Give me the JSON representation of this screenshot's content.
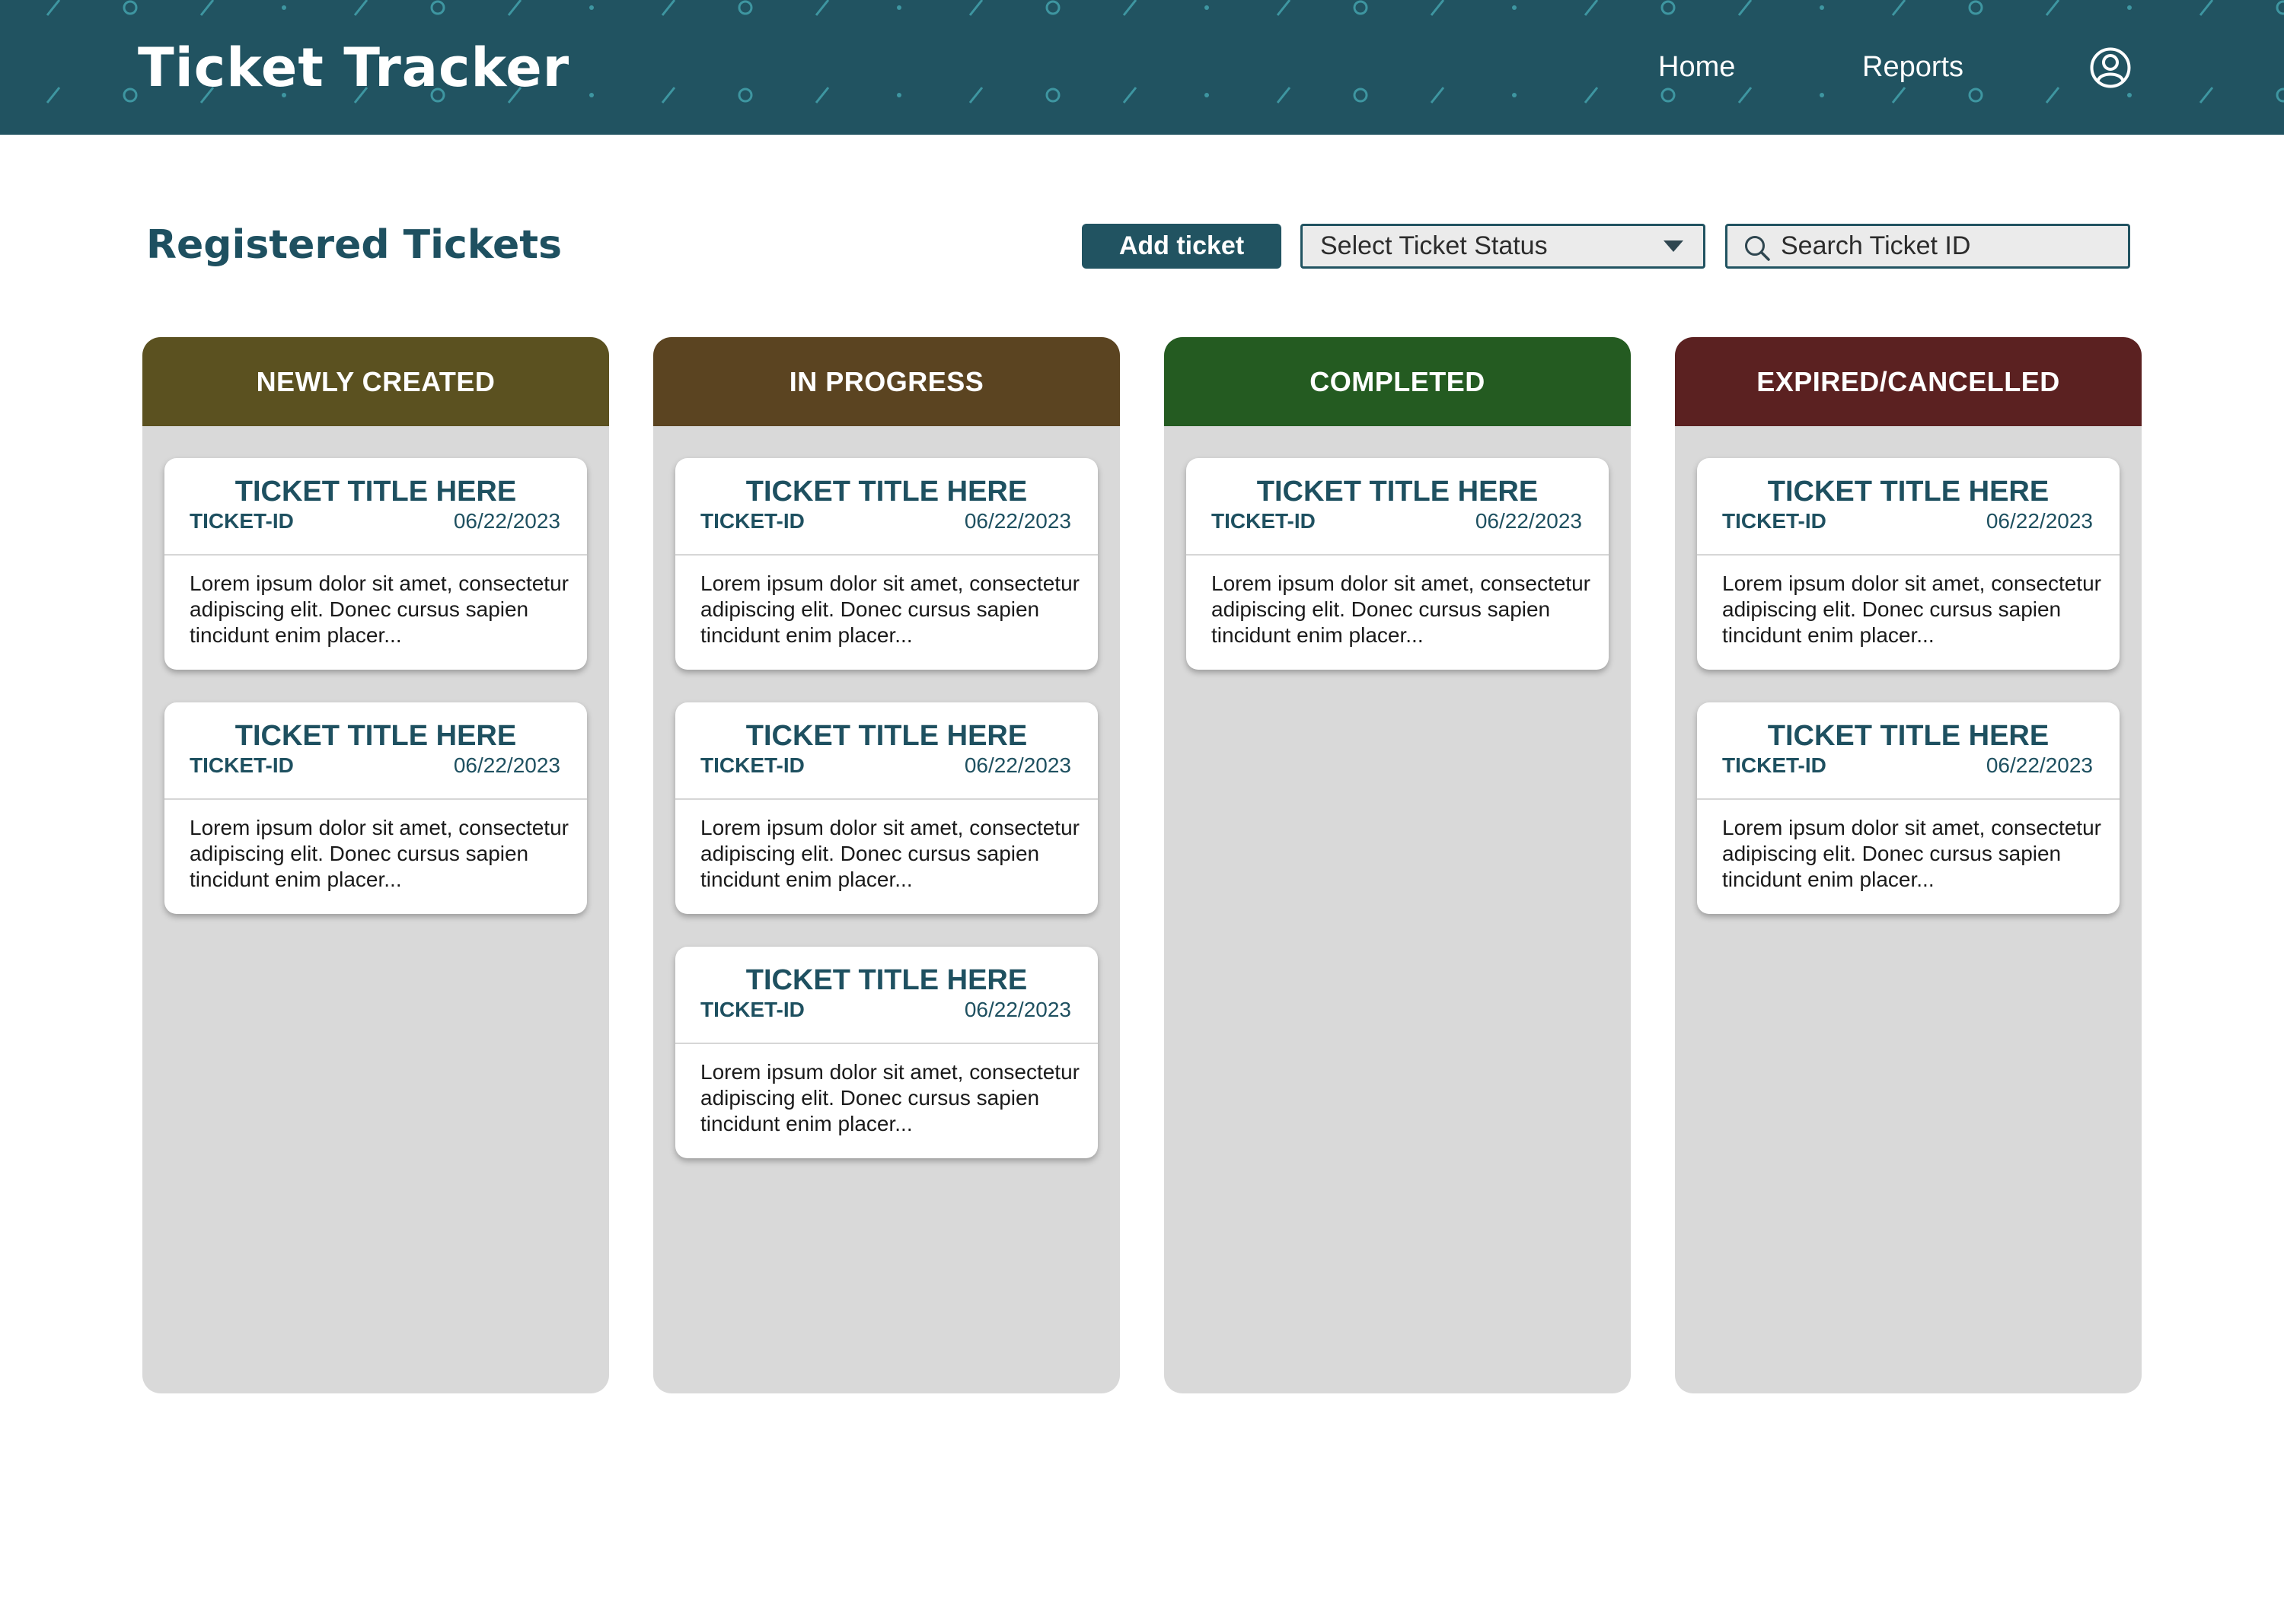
{
  "app": {
    "title": "Ticket Tracker",
    "brand_color": "#215361"
  },
  "nav": {
    "home": "Home",
    "reports": "Reports",
    "profile_icon": "user-circle-icon"
  },
  "toolbar": {
    "heading": "Registered Tickets",
    "add_label": "Add ticket",
    "status_select": {
      "selected": "Select Ticket Status"
    },
    "search": {
      "placeholder": "Search Ticket ID",
      "value": ""
    }
  },
  "columns": [
    {
      "title": "NEWLY CREATED",
      "color": "#5b5120",
      "tickets": [
        {
          "title": "TICKET TITLE HERE",
          "id": "TICKET-ID",
          "date": "06/22/2023",
          "desc": "Lorem ipsum dolor sit amet, consectetur adipiscing elit. Donec cursus sapien tincidunt enim placer..."
        },
        {
          "title": "TICKET TITLE HERE",
          "id": "TICKET-ID",
          "date": "06/22/2023",
          "desc": "Lorem ipsum dolor sit amet, consectetur adipiscing elit. Donec cursus sapien tincidunt enim placer..."
        }
      ]
    },
    {
      "title": "IN PROGRESS",
      "color": "#5b4421",
      "tickets": [
        {
          "title": "TICKET TITLE HERE",
          "id": "TICKET-ID",
          "date": "06/22/2023",
          "desc": "Lorem ipsum dolor sit amet, consectetur adipiscing elit. Donec cursus sapien tincidunt enim placer..."
        },
        {
          "title": "TICKET TITLE HERE",
          "id": "TICKET-ID",
          "date": "06/22/2023",
          "desc": "Lorem ipsum dolor sit amet, consectetur adipiscing elit. Donec cursus sapien tincidunt enim placer..."
        },
        {
          "title": "TICKET TITLE HERE",
          "id": "TICKET-ID",
          "date": "06/22/2023",
          "desc": "Lorem ipsum dolor sit amet, consectetur adipiscing elit. Donec cursus sapien tincidunt enim placer..."
        }
      ]
    },
    {
      "title": "COMPLETED",
      "color": "#245b21",
      "tickets": [
        {
          "title": "TICKET TITLE HERE",
          "id": "TICKET-ID",
          "date": "06/22/2023",
          "desc": "Lorem ipsum dolor sit amet, consectetur adipiscing elit. Donec cursus sapien tincidunt enim placer..."
        }
      ]
    },
    {
      "title": "EXPIRED/CANCELLED",
      "color": "#5b2121",
      "tickets": [
        {
          "title": "TICKET TITLE HERE",
          "id": "TICKET-ID",
          "date": "06/22/2023",
          "desc": "Lorem ipsum dolor sit amet, consectetur adipiscing elit. Donec cursus sapien tincidunt enim placer..."
        },
        {
          "title": "TICKET TITLE HERE",
          "id": "TICKET-ID",
          "date": "06/22/2023",
          "desc": "Lorem ipsum dolor sit amet, consectetur adipiscing elit. Donec cursus sapien tincidunt enim placer..."
        }
      ]
    }
  ]
}
